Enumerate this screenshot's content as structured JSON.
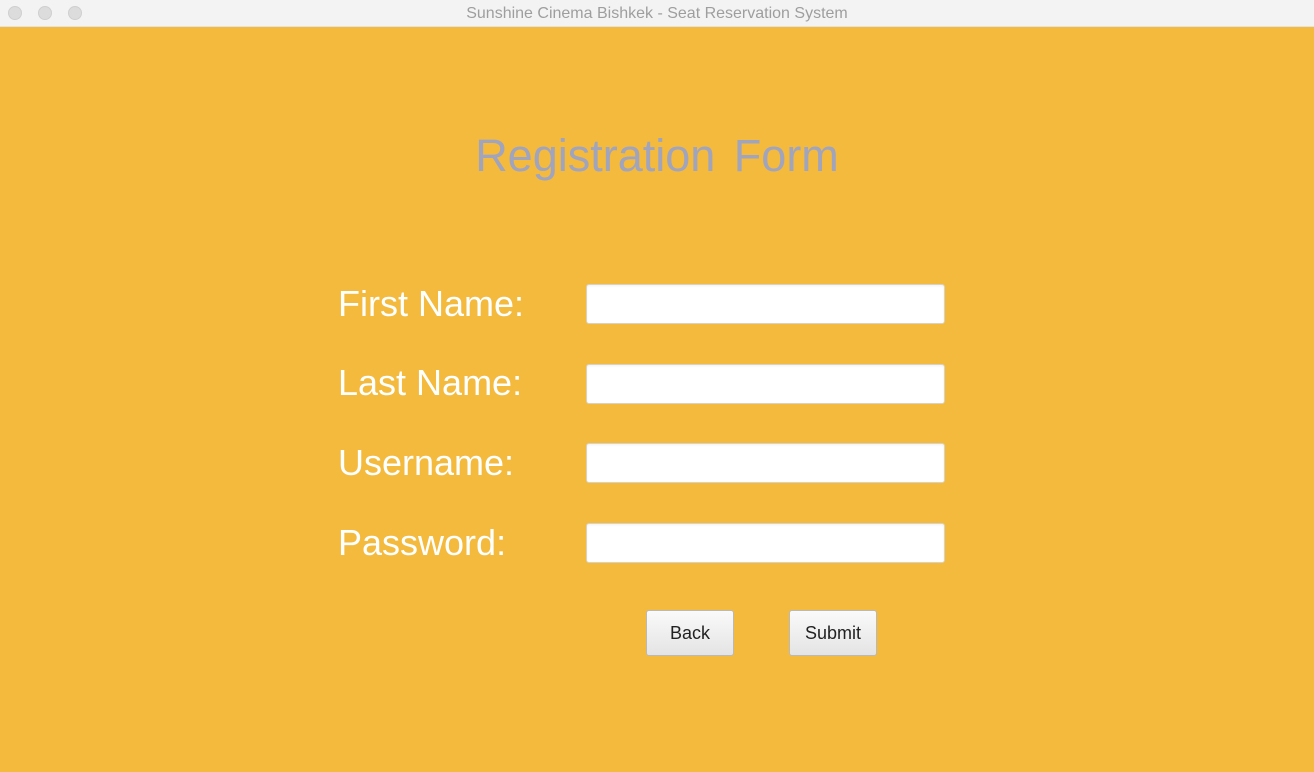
{
  "window": {
    "title": "Sunshine Cinema Bishkek - Seat Reservation System",
    "background_color": "#f3ba3e"
  },
  "form": {
    "title": "Registration Form",
    "fields": [
      {
        "label": "First Name:",
        "value": "",
        "placeholder": ""
      },
      {
        "label": "Last Name:",
        "value": "",
        "placeholder": ""
      },
      {
        "label": "Username:",
        "value": "",
        "placeholder": ""
      },
      {
        "label": "Password:",
        "value": "",
        "placeholder": ""
      }
    ],
    "buttons": {
      "back_label": "Back",
      "submit_label": "Submit"
    }
  }
}
